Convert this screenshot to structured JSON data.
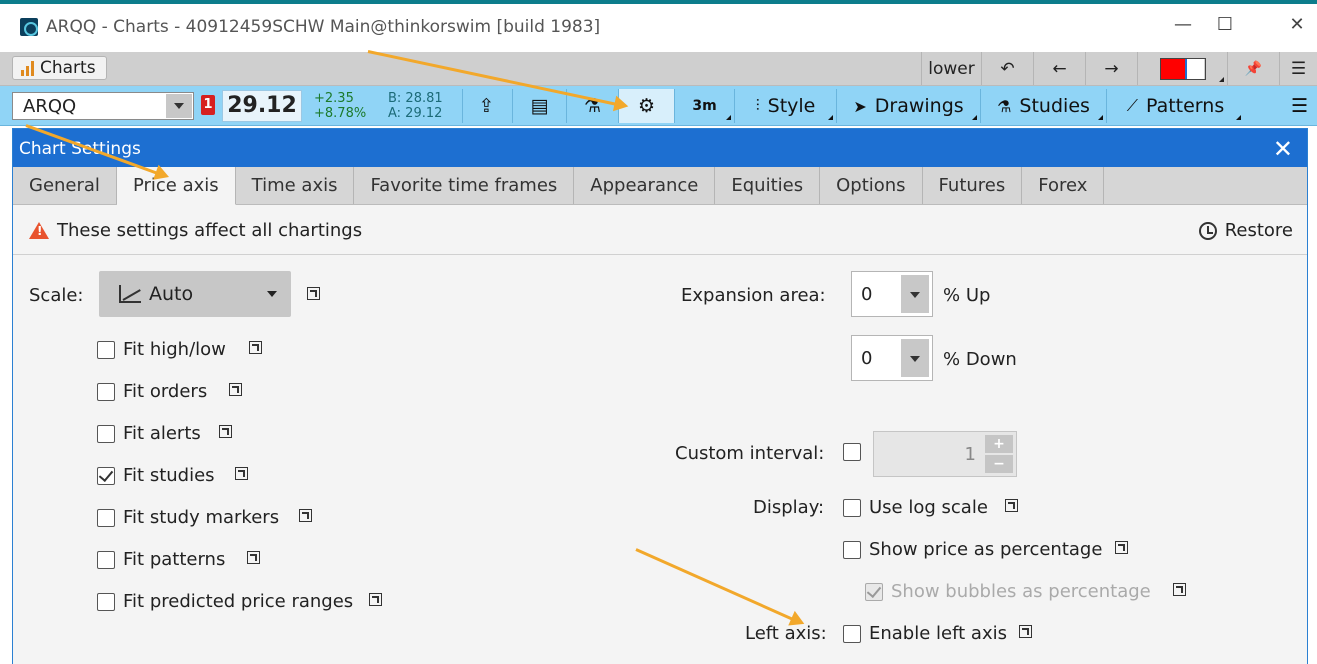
{
  "window": {
    "title": "ARQQ - Charts - 40912459SCHW Main@thinkorswim [build 1983]",
    "minimize": "—",
    "maximize": "☐",
    "close": "✕"
  },
  "strip": {
    "charts_tab": "Charts",
    "lower": "lower",
    "undo": "↶",
    "back": "←",
    "forward": "→",
    "pin": "📌",
    "menu": "☰"
  },
  "symbar": {
    "symbol": "ARQQ",
    "badge": "1",
    "price": "29.12",
    "change_abs": "+2.35",
    "change_pct": "+8.78%",
    "bid": "B: 28.81",
    "ask": "A: 29.12",
    "share_icon": "⇪",
    "calendar_icon": "▤",
    "flask_icon": "⚗",
    "gear_icon": "⚙",
    "timeframe": "3m",
    "style_label": "Style",
    "drawings_label": "Drawings",
    "studies_label": "Studies",
    "patterns_label": "Patterns",
    "menu": "☰"
  },
  "dialog": {
    "title": "Chart Settings",
    "close": "✕",
    "tabs": [
      "General",
      "Price axis",
      "Time axis",
      "Favorite time frames",
      "Appearance",
      "Equities",
      "Options",
      "Futures",
      "Forex"
    ],
    "active_tab": "Price axis",
    "notice": "These settings affect all chartings",
    "restore": "Restore"
  },
  "left": {
    "scale_label": "Scale:",
    "scale_value": "Auto",
    "checkboxes": [
      {
        "label": "Fit high/low",
        "checked": false
      },
      {
        "label": "Fit orders",
        "checked": false
      },
      {
        "label": "Fit alerts",
        "checked": false
      },
      {
        "label": "Fit studies",
        "checked": true
      },
      {
        "label": "Fit study markers",
        "checked": false
      },
      {
        "label": "Fit patterns",
        "checked": false
      },
      {
        "label": "Fit predicted price ranges",
        "checked": false
      }
    ]
  },
  "right": {
    "expansion_label": "Expansion area:",
    "up_value": "0",
    "up_unit": "% Up",
    "down_value": "0",
    "down_unit": "% Down",
    "custom_interval_label": "Custom interval:",
    "custom_interval_value": "1",
    "plus": "+",
    "minus": "−",
    "display_label": "Display:",
    "use_log_scale": "Use log scale",
    "show_price_pct": "Show price as percentage",
    "show_bubbles_pct": "Show bubbles as percentage",
    "left_axis_label": "Left axis:",
    "enable_left_axis": "Enable left axis"
  },
  "colors": {
    "titlebar_accent": "#0d7d8c",
    "symbar_bg": "#90d4f6",
    "dialog_title": "#1d6fd1",
    "arrow": "#f2a82b",
    "change_green": "#1c7a2c"
  }
}
